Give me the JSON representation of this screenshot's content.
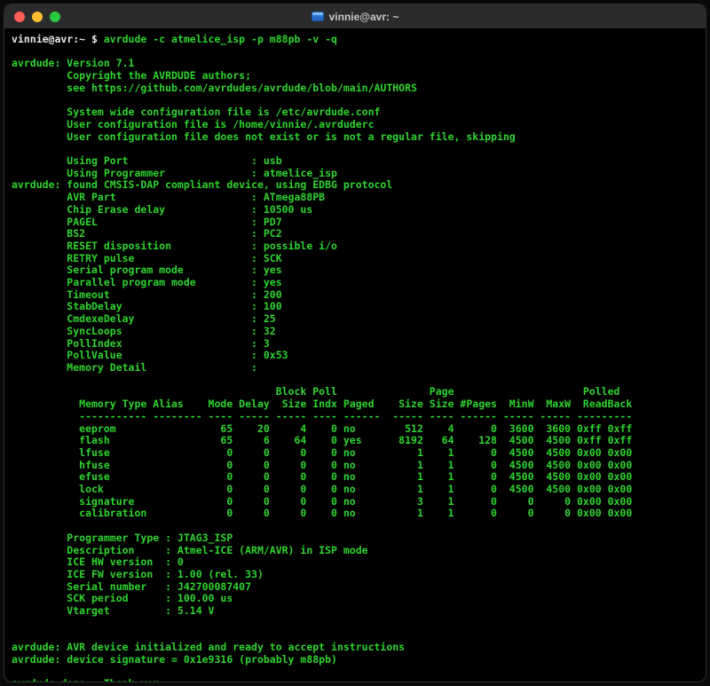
{
  "window": {
    "title": "vinnie@avr: ~",
    "colors": {
      "terminal_background": "#000000",
      "titlebar_background": "#2b2b2c",
      "title_text": "#c9c9c9",
      "output_green": "#2fd32f",
      "prompt_white": "#e9e9e9",
      "close_button": "#ff5f57",
      "minimize_button": "#febc2e",
      "zoom_button": "#28c840",
      "tab_icon_blue": "#2e7ad8"
    }
  },
  "prompt": {
    "text": "vinnie@avr:~ $ ",
    "command": "avrdude -c atmelice_isp -p m88pb -v -q"
  },
  "terminal": {
    "lines": [
      "",
      "avrdude: Version 7.1",
      "         Copyright the AVRDUDE authors;",
      "         see https://github.com/avrdudes/avrdude/blob/main/AUTHORS",
      "",
      "         System wide configuration file is /etc/avrdude.conf",
      "         User configuration file is /home/vinnie/.avrduderc",
      "         User configuration file does not exist or is not a regular file, skipping",
      "",
      "         Using Port                    : usb",
      "         Using Programmer              : atmelice_isp",
      "avrdude: found CMSIS-DAP compliant device, using EDBG protocol",
      "         AVR Part                      : ATmega88PB",
      "         Chip Erase delay              : 10500 us",
      "         PAGEL                         : PD7",
      "         BS2                           : PC2",
      "         RESET disposition             : possible i/o",
      "         RETRY pulse                   : SCK",
      "         Serial program mode           : yes",
      "         Parallel program mode         : yes",
      "         Timeout                       : 200",
      "         StabDelay                     : 100",
      "         CmdexeDelay                   : 25",
      "         SyncLoops                     : 32",
      "         PollIndex                     : 3",
      "         PollValue                     : 0x53",
      "         Memory Detail                 :",
      "",
      "                                           Block Poll               Page                     Polled",
      "           Memory Type Alias    Mode Delay  Size Indx Paged    Size Size #Pages  MinW  MaxW  ReadBack",
      "           ----------- -------- ---- ----- ----- ---- ------  ----- ---- ------ ----- ----- ---------",
      "           eeprom                 65    20     4    0 no        512    4      0  3600  3600 0xff 0xff",
      "           flash                  65     6    64    0 yes      8192   64    128  4500  4500 0xff 0xff",
      "           lfuse                   0     0     0    0 no          1    1      0  4500  4500 0x00 0x00",
      "           hfuse                   0     0     0    0 no          1    1      0  4500  4500 0x00 0x00",
      "           efuse                   0     0     0    0 no          1    1      0  4500  4500 0x00 0x00",
      "           lock                    0     0     0    0 no          1    1      0  4500  4500 0x00 0x00",
      "           signature               0     0     0    0 no          3    1      0     0     0 0x00 0x00",
      "           calibration             0     0     0    0 no          1    1      0     0     0 0x00 0x00",
      "",
      "         Programmer Type : JTAG3_ISP",
      "         Description     : Atmel-ICE (ARM/AVR) in ISP mode",
      "         ICE HW version  : 0",
      "         ICE FW version  : 1.00 (rel. 33)",
      "         Serial number   : J42700087407",
      "         SCK period      : 100.00 us",
      "         Vtarget         : 5.14 V",
      "",
      "",
      "avrdude: AVR device initialized and ready to accept instructions",
      "avrdude: device signature = 0x1e9316 (probably m88pb)",
      "",
      "avrdude done.  Thank you."
    ]
  }
}
